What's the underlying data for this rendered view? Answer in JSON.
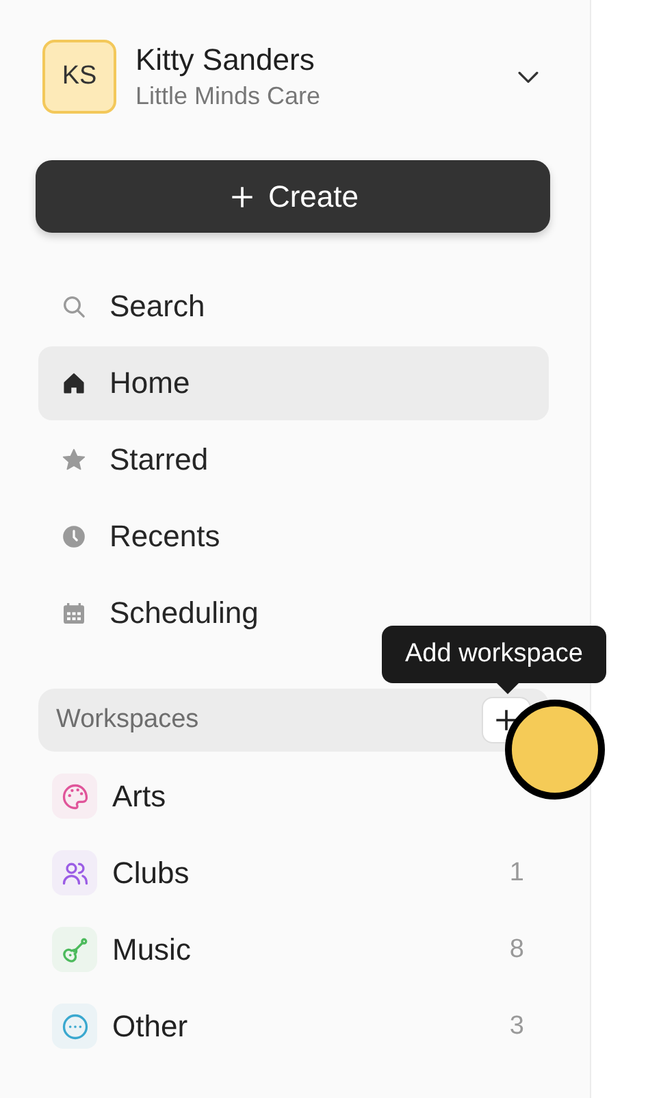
{
  "account": {
    "initials": "KS",
    "name": "Kitty Sanders",
    "organization": "Little Minds Care"
  },
  "create_button": {
    "label": "Create"
  },
  "nav": [
    {
      "kind": "search",
      "label": "Search",
      "selected": false
    },
    {
      "kind": "home",
      "label": "Home",
      "selected": true
    },
    {
      "kind": "star",
      "label": "Starred",
      "selected": false
    },
    {
      "kind": "clock",
      "label": "Recents",
      "selected": false
    },
    {
      "kind": "calendar",
      "label": "Scheduling",
      "selected": false
    }
  ],
  "workspaces": {
    "title": "Workspaces",
    "tooltip": "Add workspace",
    "items": [
      {
        "kind": "palette",
        "label": "Arts",
        "color": "#e0559a"
      },
      {
        "kind": "people",
        "label": "Clubs",
        "count": "1",
        "color": "#9b5de5"
      },
      {
        "kind": "guitar",
        "label": "Music",
        "count": "8",
        "color": "#4cba5c"
      },
      {
        "kind": "dots",
        "label": "Other",
        "count": "3",
        "color": "#3aa8cf"
      }
    ]
  }
}
